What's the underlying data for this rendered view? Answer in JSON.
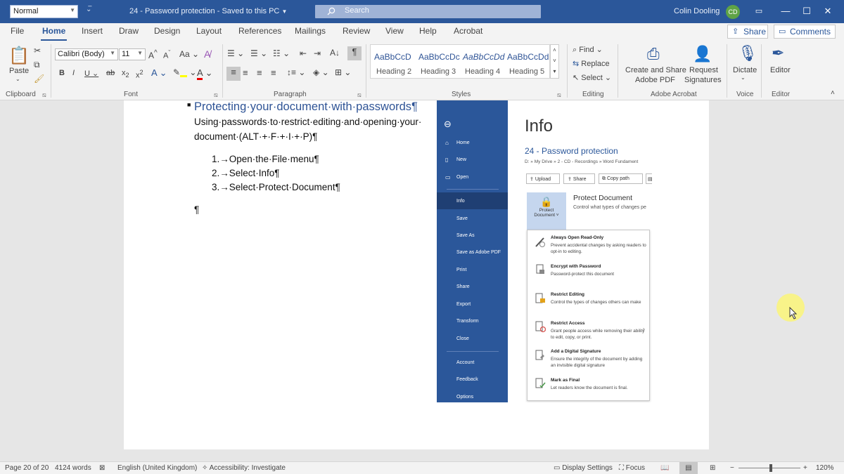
{
  "titlebar": {
    "style_box": "Normal",
    "doc_title": "24 - Password protection  -  Saved to this PC",
    "search_placeholder": "Search",
    "user_name": "Colin Dooling",
    "user_initials": "CD"
  },
  "tabs": [
    "File",
    "Home",
    "Insert",
    "Draw",
    "Design",
    "Layout",
    "References",
    "Mailings",
    "Review",
    "View",
    "Help",
    "Acrobat"
  ],
  "share_label": "Share",
  "comments_label": "Comments",
  "ribbon": {
    "clipboard": {
      "paste": "Paste",
      "group": "Clipboard"
    },
    "font": {
      "name": "Calibri (Body)",
      "size": "11",
      "group": "Font"
    },
    "paragraph": {
      "group": "Paragraph"
    },
    "styles": {
      "group": "Styles",
      "items": [
        {
          "sample": "AaBbCcD",
          "name": "Heading 2"
        },
        {
          "sample": "AaBbCcDc",
          "name": "Heading 3"
        },
        {
          "sample": "AaBbCcDd",
          "name": "Heading 4"
        },
        {
          "sample": "AaBbCcDd",
          "name": "Heading 5"
        }
      ]
    },
    "editing": {
      "find": "Find",
      "replace": "Replace",
      "select": "Select",
      "group": "Editing"
    },
    "acrobat": {
      "create_share_1": "Create and Share",
      "create_share_2": "Adobe PDF",
      "request_1": "Request",
      "request_2": "Signatures",
      "group": "Adobe Acrobat"
    },
    "voice": {
      "dictate": "Dictate",
      "group": "Voice"
    },
    "editor": {
      "label": "Editor",
      "group": "Editor"
    }
  },
  "document": {
    "heading": "Protecting·your·document·with·passwords¶",
    "para_line1": "Using·passwords·to·restrict·editing·and·opening·your·",
    "para_line2": "document·(ALT·+·F·+·I·+·P)¶",
    "steps": [
      "1.→Open·the·File·menu¶",
      "2.→Select·Info¶",
      "3.→Select·Protect·Document¶"
    ],
    "empty_para": "¶"
  },
  "screenshot": {
    "sidebar_items": [
      "Home",
      "New",
      "Open",
      "Info",
      "Save",
      "Save As",
      "Save as Adobe PDF",
      "Print",
      "Share",
      "Export",
      "Transform",
      "Close",
      "Account",
      "Feedback",
      "Options"
    ],
    "info_title": "Info",
    "doc_name": "24 - Password protection",
    "path": "D: » My Drive » 2 - CD - Recordings » Word Fundament",
    "buttons": [
      "Upload",
      "Share",
      "Copy path"
    ],
    "protect_btn_1": "Protect",
    "protect_btn_2": "Document",
    "protect_title": "Protect Document",
    "protect_desc": "Control what types of changes pe",
    "menu": [
      {
        "title": "Always Open Read-Only",
        "desc": "Prevent accidental changes by asking readers to opt-in to editing."
      },
      {
        "title": "Encrypt with Password",
        "desc": "Password-protect this document"
      },
      {
        "title": "Restrict Editing",
        "desc": "Control the types of changes others can make"
      },
      {
        "title": "Restrict Access",
        "desc": "Grant people access while removing their ability to edit, copy, or print."
      },
      {
        "title": "Add a Digital Signature",
        "desc": "Ensure the integrity of the document by adding an invisible digital signature"
      },
      {
        "title": "Mark as Final",
        "desc": "Let readers know the document is final."
      }
    ]
  },
  "statusbar": {
    "page": "Page 20 of 20",
    "words": "4124 words",
    "language": "English (United Kingdom)",
    "accessibility": "Accessibility: Investigate",
    "display_settings": "Display Settings",
    "focus": "Focus",
    "zoom": "120%"
  }
}
